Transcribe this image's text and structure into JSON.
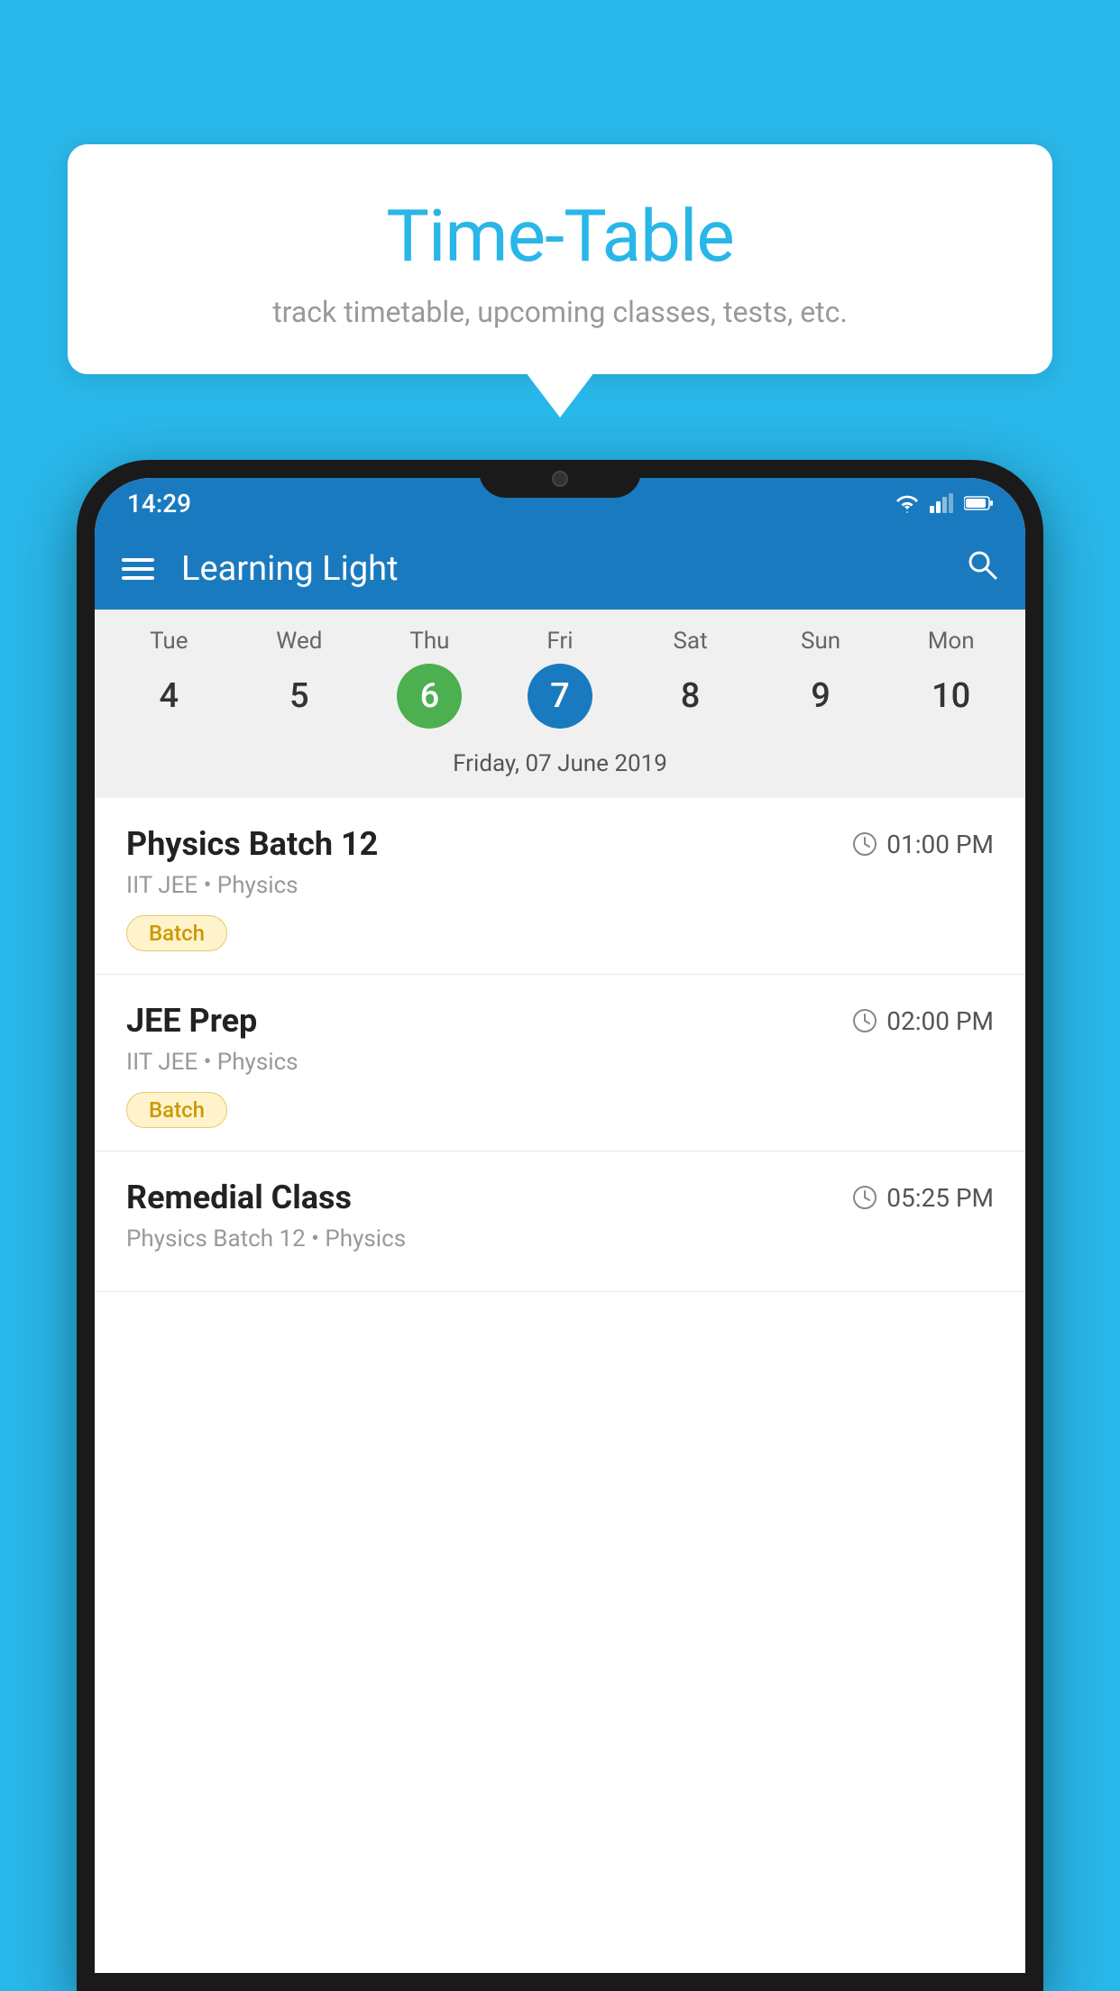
{
  "background_color": "#29b6e8",
  "speech_bubble": {
    "title": "Time-Table",
    "subtitle": "track timetable, upcoming classes, tests, etc."
  },
  "phone": {
    "status_bar": {
      "time": "14:29"
    },
    "app_bar": {
      "title": "Learning Light"
    },
    "calendar": {
      "days": [
        {
          "label": "Tue",
          "num": "4",
          "state": "normal"
        },
        {
          "label": "Wed",
          "num": "5",
          "state": "normal"
        },
        {
          "label": "Thu",
          "num": "6",
          "state": "today"
        },
        {
          "label": "Fri",
          "num": "7",
          "state": "selected"
        },
        {
          "label": "Sat",
          "num": "8",
          "state": "normal"
        },
        {
          "label": "Sun",
          "num": "9",
          "state": "normal"
        },
        {
          "label": "Mon",
          "num": "10",
          "state": "normal"
        }
      ],
      "selected_date": "Friday, 07 June 2019"
    },
    "schedule": [
      {
        "title": "Physics Batch 12",
        "time": "01:00 PM",
        "meta": "IIT JEE • Physics",
        "tag": "Batch"
      },
      {
        "title": "JEE Prep",
        "time": "02:00 PM",
        "meta": "IIT JEE • Physics",
        "tag": "Batch"
      },
      {
        "title": "Remedial Class",
        "time": "05:25 PM",
        "meta": "Physics Batch 12 • Physics",
        "tag": null
      }
    ]
  }
}
